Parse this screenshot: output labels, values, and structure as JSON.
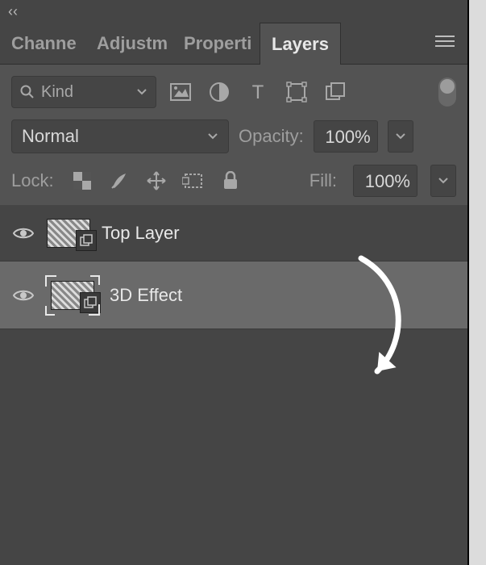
{
  "collapse_glyph": "‹‹",
  "tabs": [
    "Channe",
    "Adjustm",
    "Properti",
    "Layers"
  ],
  "active_tab_index": 3,
  "filter": {
    "placeholder": "Kind"
  },
  "blend_mode": "Normal",
  "opacity": {
    "label": "Opacity:",
    "value": "100%"
  },
  "lock": {
    "label": "Lock:"
  },
  "fill": {
    "label": "Fill:",
    "value": "100%"
  },
  "layers": [
    {
      "name": "Top Layer",
      "visible": true,
      "selected": false,
      "smart": true
    },
    {
      "name": "3D Effect",
      "visible": true,
      "selected": true,
      "smart": true
    }
  ]
}
